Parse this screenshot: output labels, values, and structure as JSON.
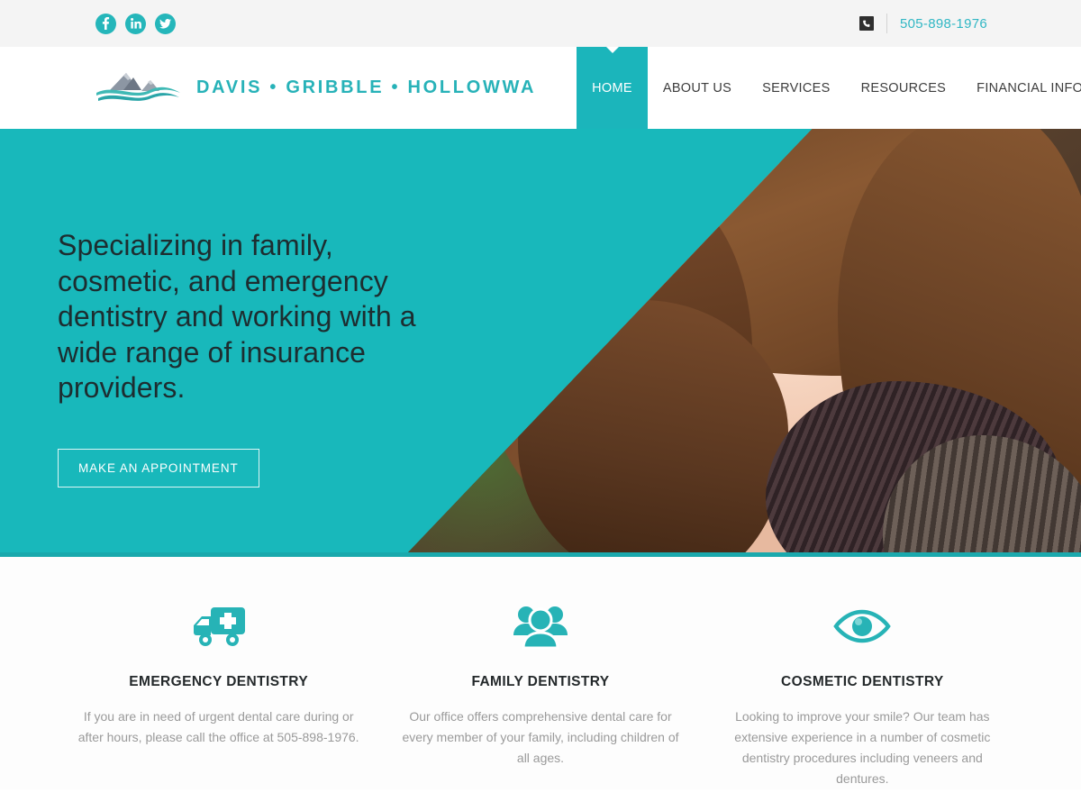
{
  "topbar": {
    "social": [
      {
        "name": "facebook",
        "label": "Facebook"
      },
      {
        "name": "linkedin",
        "label": "LinkedIn"
      },
      {
        "name": "twitter",
        "label": "Twitter"
      }
    ],
    "phone_icon": "phone-icon",
    "phone": "505-898-1976"
  },
  "header": {
    "logo_icon": "mountain-wave-logo",
    "logo_text": "DAVIS • GRIBBLE • HOLLOWWA",
    "nav": [
      {
        "label": "HOME",
        "active": true
      },
      {
        "label": "ABOUT US",
        "active": false
      },
      {
        "label": "SERVICES",
        "active": false
      },
      {
        "label": "RESOURCES",
        "active": false
      },
      {
        "label": "FINANCIAL INFORMATION",
        "active": false
      }
    ]
  },
  "hero": {
    "heading": "Specializing in family, cosmetic, and emergency dentistry and working with a wide range of insurance providers.",
    "cta_label": "MAKE AN APPOINTMENT",
    "photo_alt": "smiling-woman-photo"
  },
  "services": [
    {
      "icon": "ambulance-icon",
      "title": "EMERGENCY DENTISTRY",
      "text": "If you are in need of urgent dental care during or after hours, please call the office at 505-898-1976."
    },
    {
      "icon": "people-group-icon",
      "title": "FAMILY DENTISTRY",
      "text": "Our office offers comprehensive dental care for every member of your family, including children of all ages."
    },
    {
      "icon": "eye-icon",
      "title": "COSMETIC DENTISTRY",
      "text": "Looking to improve your smile?  Our team has extensive experience in a number of cosmetic dentistry procedures including veneers and dentures."
    }
  ],
  "colors": {
    "teal": "#18b8bb",
    "teal_dark": "#1aa9ad",
    "social_teal": "#25b6ba",
    "phone_link": "#31b7c4",
    "topbar_bg": "#f4f4f4",
    "heading_dark": "#1d2d30",
    "body_gray": "#9a9a9a"
  }
}
